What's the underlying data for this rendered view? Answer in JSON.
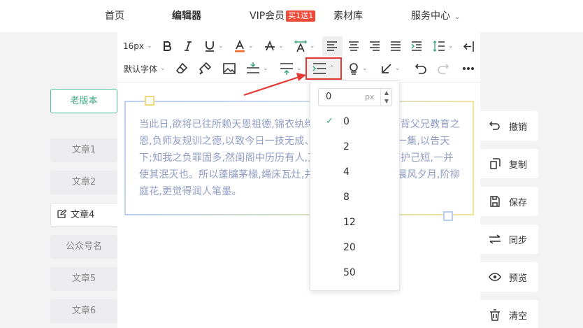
{
  "nav": {
    "items": [
      {
        "label": "首页"
      },
      {
        "label": "编辑器"
      },
      {
        "label": "VIP会员"
      },
      {
        "label": "素材库"
      },
      {
        "label": "服务中心"
      }
    ],
    "vip_badge": "买1送1"
  },
  "sidebar": {
    "old_version": "老版本",
    "items": [
      {
        "label": "文章1"
      },
      {
        "label": "文章2"
      },
      {
        "label": "文章4"
      },
      {
        "label": "公众号名"
      },
      {
        "label": "文章5"
      },
      {
        "label": "文章6"
      }
    ]
  },
  "toolbar": {
    "font_size": "16px",
    "font_family": "默认字体"
  },
  "editor": {
    "content": "当此日,欲将已往所赖天恩祖德,锦衣纨绔之时,饫甘餍肥之日,背父兄教育之恩,负师友规训之德,以致今日一技无成、半生潦倒之罪,编述一集,以告天下;知我之负罪固多,然闺阁中历历有人,万不可因我之不肖,自护己短,一并使其泯灭也。所以蓬牖茅椽,绳床瓦灶,并不足妨我襟怀;况那晨风夕月,阶柳庭花,更觉得润人笔墨。"
  },
  "dropdown": {
    "input_value": "0",
    "unit": "px",
    "options": [
      "0",
      "2",
      "4",
      "8",
      "12",
      "20",
      "50"
    ],
    "selected": "0"
  },
  "actions": [
    {
      "label": "撤销",
      "icon": "undo-icon"
    },
    {
      "label": "复制",
      "icon": "copy-icon"
    },
    {
      "label": "保存",
      "icon": "save-icon"
    },
    {
      "label": "同步",
      "icon": "sync-icon"
    },
    {
      "label": "预览",
      "icon": "eye-icon"
    },
    {
      "label": "清空",
      "icon": "trash-icon"
    }
  ],
  "colors": {
    "accent": "#3aa87c",
    "highlight_red": "#e53935",
    "content_text": "#8f9cc4"
  }
}
